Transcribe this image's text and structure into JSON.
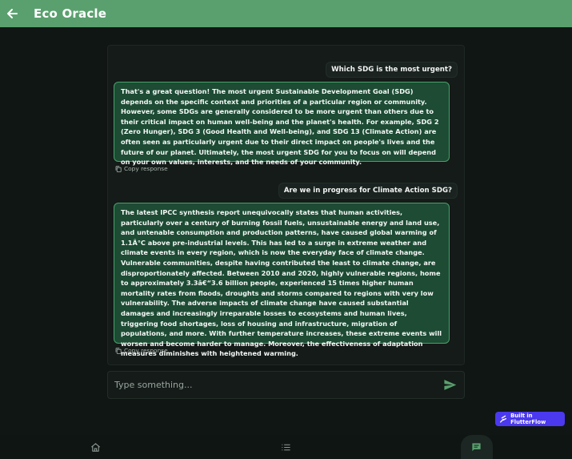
{
  "app": {
    "title": "Eco Oracle"
  },
  "messages": [
    {
      "role": "user",
      "text": "Which SDG is the most urgent?"
    },
    {
      "role": "assistant",
      "text": "That's a great question! The most urgent Sustainable Development Goal (SDG) depends on the specific context and priorities of a particular region or community. However, some SDGs are generally considered to be more urgent than others due to their critical impact on human well-being and the planet's health. For example, SDG 2 (Zero Hunger), SDG 3 (Good Health and Well-being), and SDG 13 (Climate Action) are often seen as particularly urgent due to their direct impact on people's lives and the future of our planet. Ultimately, the most urgent SDG for you to focus on will depend on your own values, interests, and the needs of your community.",
      "copy_label": "Copy response"
    },
    {
      "role": "user",
      "text": "Are we in progress for Climate Action SDG?"
    },
    {
      "role": "assistant",
      "text": "The latest IPCC synthesis report unequivocally states that human activities, particularly over a century of burning fossil fuels, unsustainable energy and land use, and untenable consumption and production patterns, have caused global warming of 1.1Â°C above pre-industrial levels. This has led to a surge in extreme weather and climate events in every region, which is now the everyday face of climate change. Vulnerable communities, despite having contributed the least to climate change, are disproportionately affected. Between 2010 and 2020, highly vulnerable regions, home to approximately 3.3â€“3.6 billion people, experienced 15 times higher human mortality rates from floods, droughts and storms compared to regions with very low vulnerability. The adverse impacts of climate change have caused substantial damages and increasingly irreparable losses to ecosystems and human lives, triggering food shortages, loss of housing and infrastructure, migration of populations, and more. With further temperature increases, these extreme events will worsen and become harder to manage. Moreover, the effectiveness of adaptation measures diminishes with heightened warming.",
      "copy_label": "Copy response"
    }
  ],
  "composer": {
    "placeholder": "Type something..."
  },
  "badge": {
    "label": "Built in FlutterFlow"
  },
  "nav": {
    "items": [
      {
        "icon": "home-icon",
        "active": false
      },
      {
        "icon": "list-icon",
        "active": false
      },
      {
        "icon": "chat-icon",
        "active": true
      }
    ]
  },
  "colors": {
    "appbar": "#5aa06e",
    "background": "#101614",
    "assistant_bubble": "#1d4b34",
    "assistant_border": "#4aa06a",
    "send_icon": "#5aa06e",
    "badge": "#4b39ef"
  }
}
